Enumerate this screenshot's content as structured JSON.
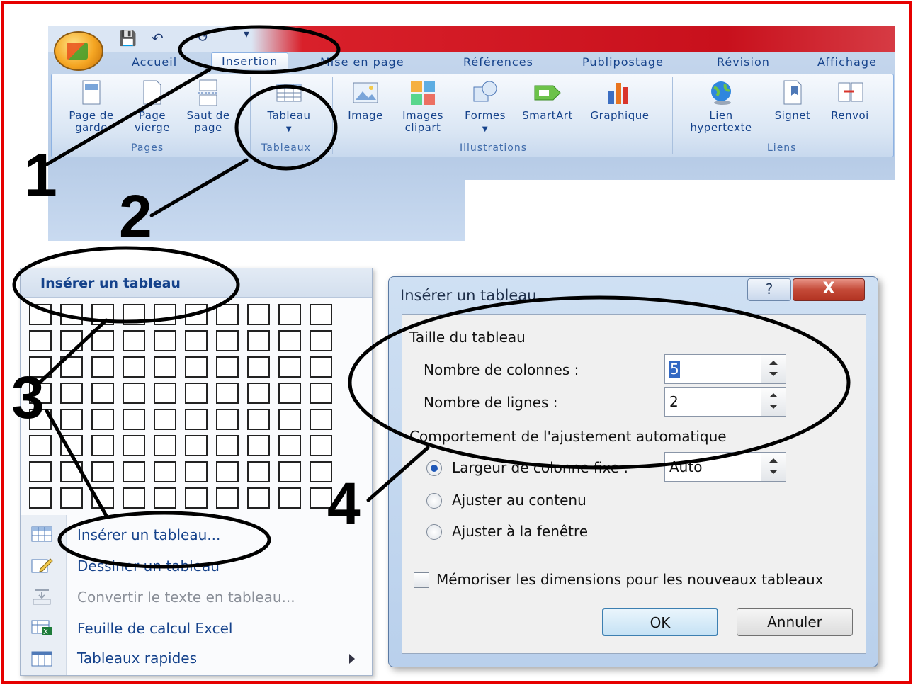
{
  "ribbon": {
    "tabs": [
      "Accueil",
      "Insertion",
      "Mise en page",
      "Références",
      "Publipostage",
      "Révision",
      "Affichage"
    ],
    "active_tab": "Insertion",
    "buttons": {
      "page_de_garde": [
        "Page de",
        "garde"
      ],
      "page_vierge": [
        "Page",
        "vierge"
      ],
      "saut_de_page": [
        "Saut de",
        "page"
      ],
      "tableau": "Tableau",
      "image": "Image",
      "images_clipart": [
        "Images",
        "clipart"
      ],
      "formes": "Formes",
      "smartart": "SmartArt",
      "graphique": "Graphique",
      "lien_hypertexte": [
        "Lien",
        "hypertexte"
      ],
      "signet": "Signet",
      "renvoi": "Renvoi"
    },
    "groups": {
      "pages": "Pages",
      "tableaux": "Tableaux",
      "illustrations": "Illustrations",
      "liens": "Liens"
    }
  },
  "menu": {
    "header": "Insérer un tableau",
    "grid": {
      "columns": 10,
      "rows": 8
    },
    "items": [
      {
        "label": "Insérer un tableau...",
        "enabled": true
      },
      {
        "label": "Dessiner un tableau",
        "enabled": true
      },
      {
        "label": "Convertir le texte en tableau...",
        "enabled": false
      },
      {
        "label": "Feuille de calcul Excel",
        "enabled": true
      },
      {
        "label": "Tableaux rapides",
        "enabled": true
      }
    ]
  },
  "dialog": {
    "title": "Insérer un tableau",
    "help": "?",
    "close": "X",
    "section_size": "Taille du tableau",
    "columns_label": "Nombre de colonnes :",
    "columns_value": "5",
    "rows_label": "Nombre de lignes :",
    "rows_value": "2",
    "section_autofit": "Comportement de l'ajustement automatique",
    "fixed_width_label": "Largeur de colonne fixe :",
    "fixed_width_value": "Auto",
    "fit_content_label": "Ajuster au contenu",
    "fit_window_label": "Ajuster à la fenêtre",
    "remember_label": "Mémoriser les dimensions pour les nouveaux tableaux",
    "ok": "OK",
    "cancel": "Annuler",
    "selected_option": "fixed_width",
    "remember_checked": false
  },
  "annotations": [
    "1",
    "2",
    "3",
    "4"
  ],
  "colors": {
    "frame": "#e60000",
    "ribbon_text": "#15428b",
    "annotation": "#000000"
  }
}
